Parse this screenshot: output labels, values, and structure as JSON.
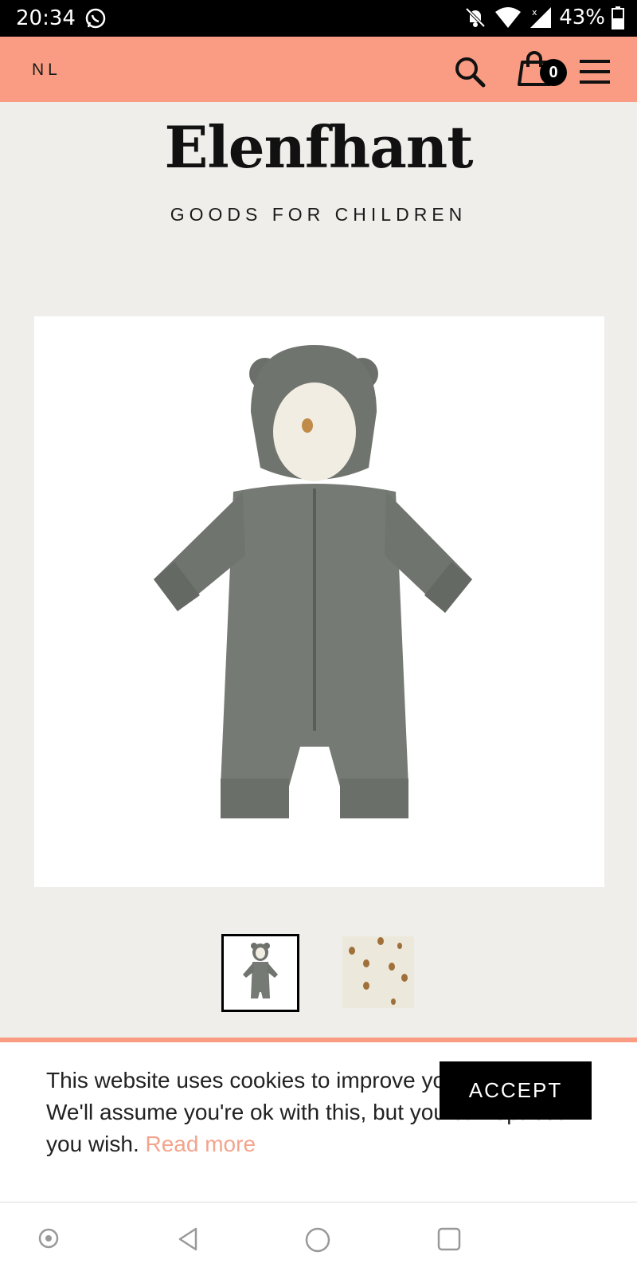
{
  "status_bar": {
    "time": "20:34",
    "battery": "43%",
    "icons": [
      "whatsapp-icon",
      "bell-muted-icon",
      "wifi-icon",
      "signal-icon",
      "battery-icon"
    ]
  },
  "header": {
    "language": "NL",
    "cart_count": "0",
    "icons": [
      "search-icon",
      "shopping-bag-icon",
      "hamburger-menu-icon"
    ],
    "background": "#f99c83"
  },
  "brand": {
    "logo": "Elenfhant",
    "tagline": "GOODS FOR CHILDREN"
  },
  "product": {
    "image": "grey corduroy baby snowsuit with bear ears hood",
    "thumbnails": [
      "snowsuit thumbnail",
      "lemon pattern thumbnail"
    ]
  },
  "cookie": {
    "message": "This website uses cookies to improve your experience. We'll assume you're ok with this, but you can opt-out if you wish.",
    "read_more": "Read more",
    "accept_label": "ACCEPT",
    "link_color": "#f3a48d"
  },
  "nav_bar": {
    "icons": [
      "record-icon",
      "back-icon",
      "home-icon",
      "recents-icon"
    ]
  }
}
